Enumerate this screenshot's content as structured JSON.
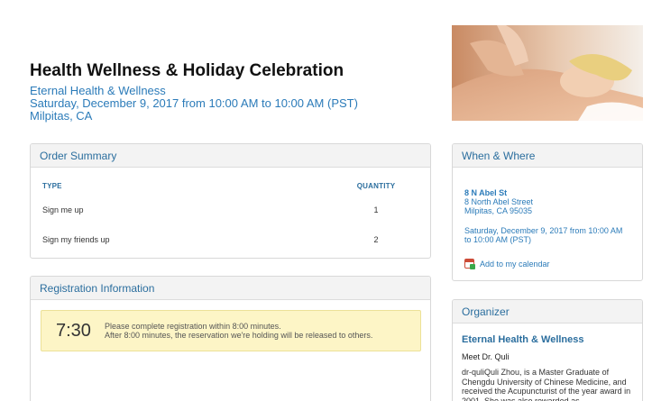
{
  "event": {
    "title": "Health Wellness & Holiday Celebration",
    "organizer": "Eternal Health & Wellness",
    "datetime": "Saturday, December 9, 2017 from 10:00 AM to 10:00 AM (PST)",
    "location": "Milpitas, CA"
  },
  "hero_image": {
    "alt": "woman-receiving-massage"
  },
  "order_summary": {
    "heading": "Order Summary",
    "col_type": "TYPE",
    "col_quantity": "QUANTITY",
    "rows": [
      {
        "type": "Sign me up",
        "quantity": "1"
      },
      {
        "type": "Sign my friends up",
        "quantity": "2"
      }
    ]
  },
  "registration": {
    "heading": "Registration Information",
    "timer": "7:30",
    "message_line1": "Please complete registration within 8:00 minutes.",
    "message_line2": "After 8:00 minutes, the reservation we're holding will be released to others."
  },
  "when_where": {
    "heading": "When & Where",
    "venue": "8 N Abel St",
    "street": "8 North Abel Street",
    "city": "Milpitas, CA 95035",
    "datetime": "Saturday, December 9, 2017 from 10:00 AM to 10:00 AM (PST)",
    "calendar_link": "Add to my calendar",
    "calendar_icon": "calendar-icon"
  },
  "organizer_panel": {
    "heading": "Organizer",
    "name": "Eternal Health & Wellness",
    "subtitle": "Meet Dr. Quli",
    "bio": "dr-quliQuli Zhou, is a Master Graduate of Chengdu University of Chinese Medicine, and received the Acupuncturist of the year award in 2001. She was also rewarded as"
  },
  "colors": {
    "accent": "#2b7bb9",
    "timer_bg": "#fdf5c6",
    "panel_head_bg": "#f3f3f3"
  }
}
